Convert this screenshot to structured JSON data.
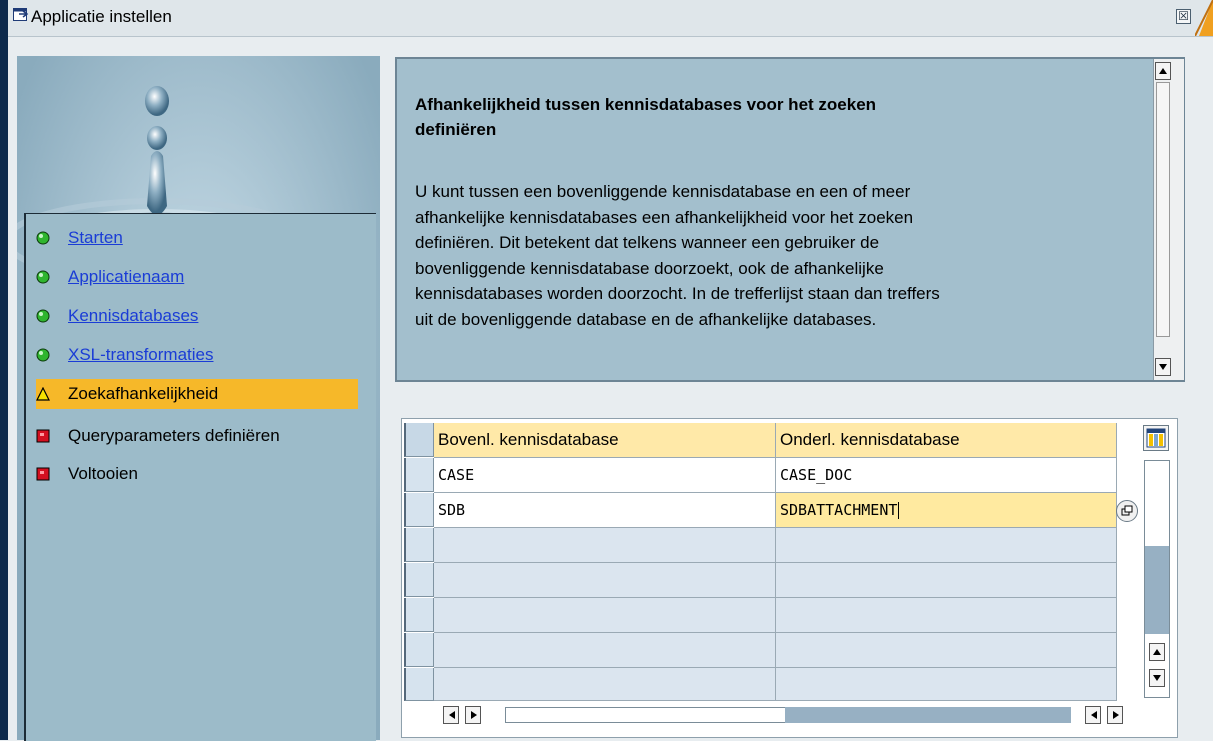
{
  "window": {
    "title": "Applicatie instellen",
    "close_glyph": "☒"
  },
  "nav": {
    "items": [
      {
        "label": "Starten",
        "status": "done",
        "bullet_color": "#2fb52f",
        "link": true
      },
      {
        "label": "Applicatienaam",
        "status": "done",
        "bullet_color": "#2fb52f",
        "link": true
      },
      {
        "label": "Kennisdatabases",
        "status": "done",
        "bullet_color": "#2fb52f",
        "link": true
      },
      {
        "label": "XSL-transformaties",
        "status": "done",
        "bullet_color": "#2fb52f",
        "link": true
      },
      {
        "label": "Zoekafhankelijkheid",
        "status": "current",
        "bullet_color": "#f6d000",
        "link": false
      },
      {
        "label": "Queryparameters definiëren",
        "status": "open",
        "bullet_color": "#d41020",
        "link": false
      },
      {
        "label": "Voltooien",
        "status": "open",
        "bullet_color": "#d41020",
        "link": false
      }
    ]
  },
  "info": {
    "heading_line1": "Afhankelijkheid tussen kennisdatabases voor het zoeken",
    "heading_line2": "definiëren",
    "body_lines": [
      "U kunt tussen een bovenliggende kennisdatabase en een of meer",
      "afhankelijke kennisdatabases een afhankelijkheid voor het zoeken",
      "definiëren. Dit betekent dat telkens wanneer een gebruiker de",
      "bovenliggende kennisdatabase doorzoekt, ook de afhankelijke",
      "kennisdatabases worden doorzocht. In de trefferlijst staan dan treffers",
      "uit de bovenliggende database en de afhankelijke databases."
    ]
  },
  "table": {
    "columns": [
      "Bovenl. kennisdatabase",
      "Onderl. kennisdatabase"
    ],
    "rows": [
      [
        "CASE",
        "CASE_DOC"
      ],
      [
        "SDB",
        "SDBATTACHMENT"
      ],
      [
        "",
        ""
      ],
      [
        "",
        ""
      ],
      [
        "",
        ""
      ],
      [
        "",
        ""
      ],
      [
        "",
        ""
      ]
    ],
    "selected_row": 1,
    "selected_col": 1
  },
  "colors": {
    "accent_active": "#f6b829",
    "link": "#1a3cd6",
    "panel": "#a3bfcd",
    "header_cell": "#ffe9a8"
  },
  "icons": {
    "window": "window-settings-icon",
    "close": "close-icon",
    "layout": "table-layout-icon",
    "value_help": "value-help-icon"
  }
}
